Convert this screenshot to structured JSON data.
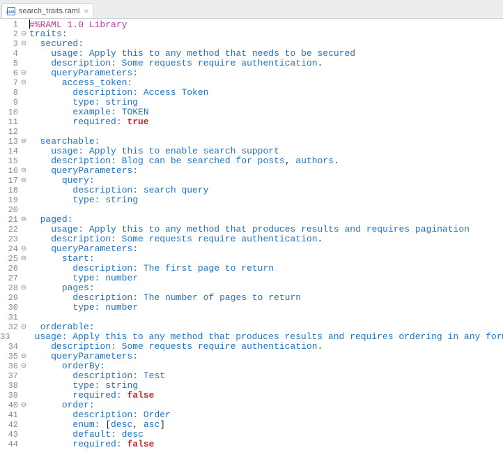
{
  "tab": {
    "filename": "search_traits.raml",
    "close_glyph": "×"
  },
  "raml_header": "#%RAML 1.0 Library",
  "code": {
    "traits": "traits:",
    "secured": {
      "name": "secured:",
      "usage_k": "usage:",
      "usage_v": " Apply this to any method that needs to be secured",
      "desc_k": "description:",
      "desc_v": " Some requests require authentication",
      "qp": "queryParameters:",
      "access_token": "access_token:",
      "at_desc_k": "description:",
      "at_desc_v": " Access Token",
      "at_type_k": "type:",
      "at_type_v": " string",
      "at_ex_k": "example:",
      "at_ex_v": " TOKEN",
      "at_req_k": "required:",
      "at_req_v": "true"
    },
    "searchable": {
      "name": "searchable:",
      "usage_k": "usage:",
      "usage_v": " Apply this to enable search support",
      "desc_k": "description:",
      "desc_v": " Blog can be searched for posts",
      "desc_v2": " authors",
      "qp": "queryParameters:",
      "query": "query:",
      "q_desc_k": "description:",
      "q_desc_v": " search query",
      "q_type_k": "type:",
      "q_type_v": " string"
    },
    "paged": {
      "name": "paged:",
      "usage_k": "usage:",
      "usage_v": " Apply this to any method that produces results and requires pagination",
      "desc_k": "description:",
      "desc_v": " Some requests require authentication",
      "qp": "queryParameters:",
      "start": "start:",
      "s_desc_k": "description:",
      "s_desc_v": " The first page to return",
      "s_type_k": "type:",
      "s_type_v": " number",
      "pages": "pages:",
      "p_desc_k": "description:",
      "p_desc_v": " The number of pages to return",
      "p_type_k": "type:",
      "p_type_v": " number"
    },
    "orderable": {
      "name": "orderable:",
      "usage_k": "usage:",
      "usage_v": " Apply this to any method that produces results and requires ordering in any format",
      "desc_k": "description:",
      "desc_v": " Some requests require authentication",
      "qp": "queryParameters:",
      "orderBy": "orderBy:",
      "ob_desc_k": "description:",
      "ob_desc_v": " Test",
      "ob_type_k": "type:",
      "ob_type_v": " string",
      "ob_req_k": "required:",
      "ob_req_v": "false",
      "order": "order:",
      "o_desc_k": "description:",
      "o_desc_v": " Order",
      "o_enum_k": "enum:",
      "o_enum_b1": " [",
      "o_enum_v1": "desc",
      "o_enum_c": ",",
      "o_enum_v2": " asc",
      "o_enum_b2": "]",
      "o_def_k": "default:",
      "o_def_v": " desc",
      "o_req_k": "required:",
      "o_req_v": "false"
    }
  },
  "fold_lines": [
    2,
    3,
    6,
    7,
    13,
    16,
    17,
    21,
    24,
    25,
    28,
    32,
    35,
    36,
    40
  ],
  "line_numbers": [
    "1",
    "2",
    "3",
    "4",
    "5",
    "6",
    "7",
    "8",
    "9",
    "10",
    "11",
    "12",
    "13",
    "14",
    "15",
    "16",
    "17",
    "18",
    "19",
    "20",
    "21",
    "22",
    "23",
    "24",
    "25",
    "26",
    "27",
    "28",
    "29",
    "30",
    "31",
    "32",
    "33",
    "34",
    "35",
    "36",
    "37",
    "38",
    "39",
    "40",
    "41",
    "42",
    "43",
    "44"
  ]
}
